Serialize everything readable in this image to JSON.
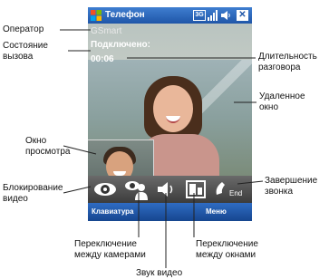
{
  "phone": {
    "title": "Телефон",
    "status_icons": [
      "windows-flag-icon",
      "3g-icon",
      "signal-icon",
      "volume-icon",
      "close-icon"
    ],
    "net_label": "3G",
    "operator": "GSmart",
    "call_status": "Подключено:",
    "call_timer": "00:06",
    "toolbar": {
      "buttons": [
        "eye-icon",
        "switch-camera-icon",
        "speaker-icon",
        "switch-window-icon",
        "end-call-icon"
      ],
      "end_label": "End"
    },
    "softkeys": {
      "left": "Клавиатура",
      "right": "Меню"
    }
  },
  "callouts": {
    "operator": "Оператор",
    "call_state": [
      "Состояние",
      "вызова"
    ],
    "duration": [
      "Длительность",
      "разговора"
    ],
    "remote_window": [
      "Удаленное",
      "окно"
    ],
    "preview_window": [
      "Окно",
      "просмотра"
    ],
    "block_video": [
      "Блокирование",
      "видео"
    ],
    "end_call": [
      "Завершение",
      "звонка"
    ],
    "switch_cameras": [
      "Переключение",
      "между камерами"
    ],
    "switch_windows": [
      "Переключение",
      "между окнами"
    ],
    "video_sound": "Звук видео"
  },
  "colors": {
    "titlebar": "#1f56a8",
    "softkeys": "#16468f",
    "toolbar": "#3c3c3c"
  }
}
